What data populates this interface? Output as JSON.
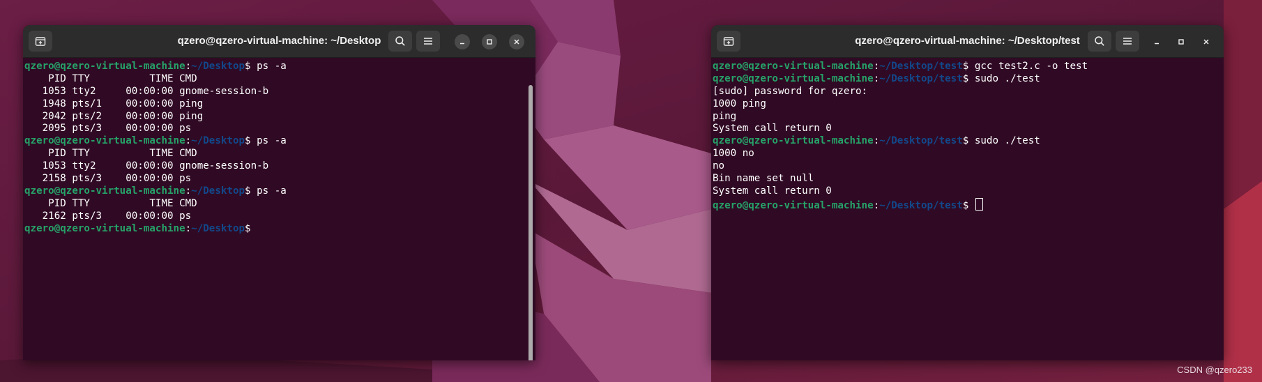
{
  "colors": {
    "terminal_bg": "#300a24",
    "user_host": "#26a269",
    "path": "#12488b",
    "titlebar": "#2c2c2c",
    "wallpaper": "#5a1a3c"
  },
  "left_window": {
    "title": "qzero@qzero-virtual-machine: ~/Desktop",
    "icons": [
      "new-tab-icon",
      "search-icon",
      "hamburger-menu-icon",
      "minimize-icon",
      "maximize-icon",
      "close-icon"
    ],
    "lines": [
      {
        "user": "qzero@qzero-virtual-machine",
        "colon": ":",
        "path": "~/Desktop",
        "cmd": "$ ps -a"
      },
      {
        "text": "    PID TTY          TIME CMD"
      },
      {
        "text": "   1053 tty2     00:00:00 gnome-session-b"
      },
      {
        "text": "   1948 pts/1    00:00:00 ping"
      },
      {
        "text": "   2042 pts/2    00:00:00 ping"
      },
      {
        "text": "   2095 pts/3    00:00:00 ps"
      },
      {
        "user": "qzero@qzero-virtual-machine",
        "colon": ":",
        "path": "~/Desktop",
        "cmd": "$ ps -a"
      },
      {
        "text": "    PID TTY          TIME CMD"
      },
      {
        "text": "   1053 tty2     00:00:00 gnome-session-b"
      },
      {
        "text": "   2158 pts/3    00:00:00 ps"
      },
      {
        "user": "qzero@qzero-virtual-machine",
        "colon": ":",
        "path": "~/Desktop",
        "cmd": "$ ps -a"
      },
      {
        "text": "    PID TTY          TIME CMD"
      },
      {
        "text": "   2162 pts/3    00:00:00 ps"
      },
      {
        "user": "qzero@qzero-virtual-machine",
        "colon": ":",
        "path": "~/Desktop",
        "cmd": "$"
      }
    ]
  },
  "right_window": {
    "title": "qzero@qzero-virtual-machine: ~/Desktop/test",
    "icons": [
      "new-tab-icon",
      "search-icon",
      "hamburger-menu-icon",
      "minimize-icon",
      "maximize-icon",
      "close-icon"
    ],
    "lines": [
      {
        "user": "qzero@qzero-virtual-machine",
        "colon": ":",
        "path": "~/Desktop/test",
        "cmd": "$ gcc test2.c -o test"
      },
      {
        "user": "qzero@qzero-virtual-machine",
        "colon": ":",
        "path": "~/Desktop/test",
        "cmd": "$ sudo ./test"
      },
      {
        "text": "[sudo] password for qzero:"
      },
      {
        "text": "1000 ping"
      },
      {
        "text": "ping"
      },
      {
        "text": "System call return 0"
      },
      {
        "user": "qzero@qzero-virtual-machine",
        "colon": ":",
        "path": "~/Desktop/test",
        "cmd": "$ sudo ./test"
      },
      {
        "text": "1000 no"
      },
      {
        "text": "no"
      },
      {
        "text": "Bin name set null"
      },
      {
        "text": "System call return 0"
      },
      {
        "user": "qzero@qzero-virtual-machine",
        "colon": ":",
        "path": "~/Desktop/test",
        "cmd": "$ ",
        "cursor": true
      }
    ]
  },
  "watermark": "CSDN @qzero233"
}
